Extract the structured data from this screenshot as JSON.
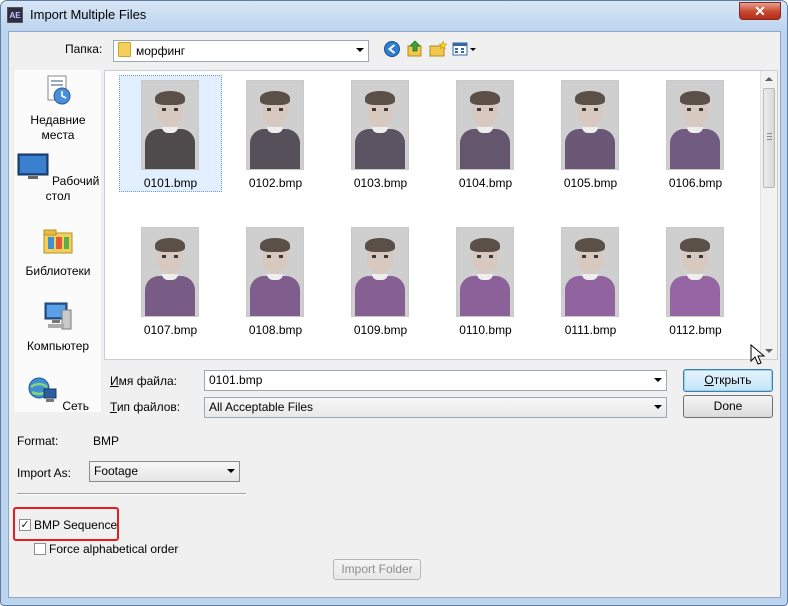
{
  "window": {
    "title": "Import Multiple Files",
    "app_icon_text": "AE",
    "close_glyph": "✕"
  },
  "lookin": {
    "label": "Папка:",
    "value": "морфинг"
  },
  "places": [
    {
      "label": "Недавние места",
      "icon": "recent-places-icon"
    },
    {
      "label": "Рабочий стол",
      "icon": "desktop-icon"
    },
    {
      "label": "Библиотеки",
      "icon": "libraries-icon"
    },
    {
      "label": "Компьютер",
      "icon": "computer-icon"
    },
    {
      "label": "Сеть",
      "icon": "network-icon"
    }
  ],
  "files": [
    {
      "name": "0101.bmp",
      "selected": true,
      "shirt": "#4f4a4c"
    },
    {
      "name": "0102.bmp",
      "selected": false,
      "shirt": "#56505a"
    },
    {
      "name": "0103.bmp",
      "selected": false,
      "shirt": "#5c5363"
    },
    {
      "name": "0104.bmp",
      "selected": false,
      "shirt": "#63566d"
    },
    {
      "name": "0105.bmp",
      "selected": false,
      "shirt": "#6b5876"
    },
    {
      "name": "0106.bmp",
      "selected": false,
      "shirt": "#725b80"
    },
    {
      "name": "0107.bmp",
      "selected": false,
      "shirt": "#795c86"
    },
    {
      "name": "0108.bmp",
      "selected": false,
      "shirt": "#7f5e8d"
    },
    {
      "name": "0109.bmp",
      "selected": false,
      "shirt": "#865f93"
    },
    {
      "name": "0110.bmp",
      "selected": false,
      "shirt": "#8c6199"
    },
    {
      "name": "0111.bmp",
      "selected": false,
      "shirt": "#91639f"
    },
    {
      "name": "0112.bmp",
      "selected": false,
      "shirt": "#9665a4"
    }
  ],
  "filename": {
    "label_first": "И",
    "label_rest": "мя файла:",
    "value": "0101.bmp"
  },
  "filetype": {
    "label_first": "Т",
    "label_rest": "ип файлов:",
    "value": "All Acceptable Files"
  },
  "buttons": {
    "open_first": "О",
    "open_rest": "ткрыть",
    "done": "Done",
    "import_folder": "Import Folder"
  },
  "format": {
    "label": "Format:",
    "value": "BMP"
  },
  "import_as": {
    "label": "Import As:",
    "value": "Footage"
  },
  "options": {
    "sequence_label": "BMP Sequence",
    "sequence_checked": true,
    "alpha_label": "Force alphabetical order",
    "alpha_checked": false
  }
}
